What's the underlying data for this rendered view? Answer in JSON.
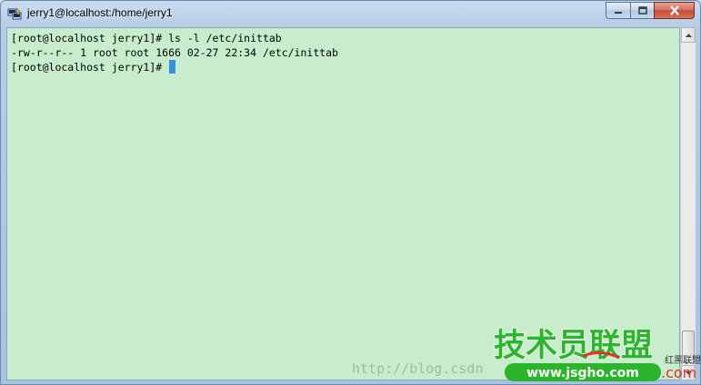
{
  "window": {
    "title": "jerry1@localhost:/home/jerry1"
  },
  "terminal": {
    "lines": [
      "[root@localhost jerry1]# ls -l /etc/inittab",
      "-rw-r--r-- 1 root root 1666 02-27 22:34 /etc/inittab",
      "[root@localhost jerry1]# "
    ]
  },
  "watermark": {
    "url": "http://blog.csdn",
    "logo_cn": "技术员联盟",
    "logo_url": "www.jsgho.com",
    "logo_side": "红黑联盟",
    "logo_com": ".com"
  },
  "colors": {
    "terminal_bg": "#c7edcc",
    "cursor": "#3a8ee6",
    "logo_green": "#2bb52b",
    "logo_red": "#e8302a"
  },
  "scrollbar": {
    "position": 1.0
  }
}
